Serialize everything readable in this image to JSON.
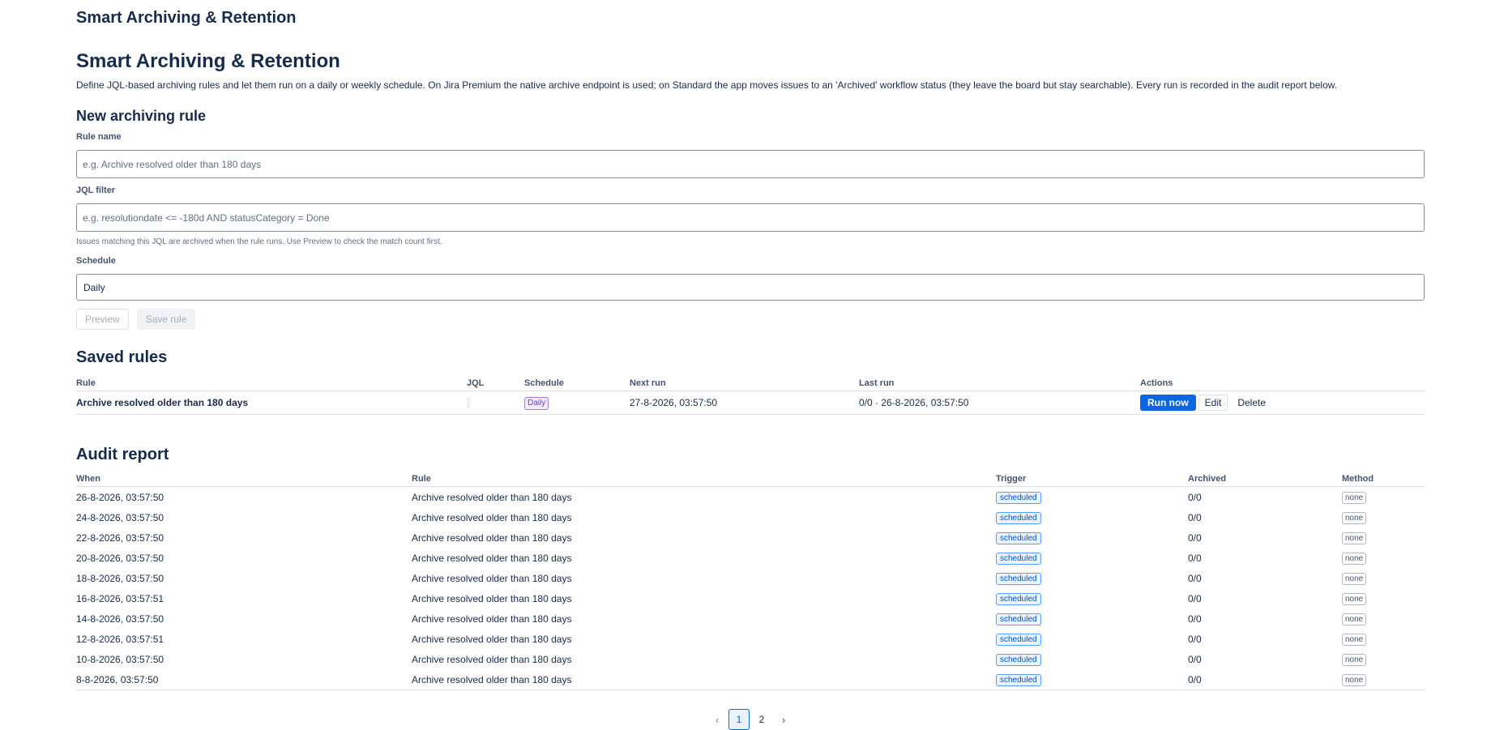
{
  "app": {
    "title": "Smart Archiving & Retention"
  },
  "main": {
    "title": "Smart Archiving & Retention",
    "description": "Define JQL-based archiving rules and let them run on a daily or weekly schedule. On Jira Premium the native archive endpoint is used; on Standard the app moves issues to an 'Archived' workflow status (they leave the board but stay searchable). Every run is recorded in the audit report below."
  },
  "new_rule": {
    "title": "New archiving rule",
    "rule_name_label": "Rule name",
    "rule_name_value": "",
    "rule_name_placeholder": "e.g. Archive resolved older than 180 days",
    "jql_label": "JQL filter",
    "jql_value": "",
    "jql_placeholder": "e.g. resolutiondate <= -180d AND statusCategory = Done",
    "jql_helper": "Issues matching this JQL are archived when the rule runs. Use Preview to check the match count first.",
    "schedule_label": "Schedule",
    "schedule_value": "Daily",
    "preview_label": "Preview",
    "save_label": "Save rule"
  },
  "saved_rules": {
    "title": "Saved rules",
    "headers": {
      "rule": "Rule",
      "jql": "JQL",
      "schedule": "Schedule",
      "next_run": "Next run",
      "last_run": "Last run",
      "actions": "Actions"
    },
    "rows": [
      {
        "rule": "Archive resolved older than 180 days",
        "schedule": "Daily",
        "next_run": "27-8-2026, 03:57:50",
        "last_run": "0/0 · 26-8-2026, 03:57:50",
        "run_now": "Run now",
        "edit": "Edit",
        "delete": "Delete"
      }
    ]
  },
  "audit": {
    "title": "Audit report",
    "headers": {
      "when": "When",
      "rule": "Rule",
      "trigger": "Trigger",
      "archived": "Archived",
      "method": "Method"
    },
    "rows": [
      {
        "when": "26-8-2026, 03:57:50",
        "rule": "Archive resolved older than 180 days",
        "trigger": "scheduled",
        "archived": "0/0",
        "method": "none"
      },
      {
        "when": "24-8-2026, 03:57:50",
        "rule": "Archive resolved older than 180 days",
        "trigger": "scheduled",
        "archived": "0/0",
        "method": "none"
      },
      {
        "when": "22-8-2026, 03:57:50",
        "rule": "Archive resolved older than 180 days",
        "trigger": "scheduled",
        "archived": "0/0",
        "method": "none"
      },
      {
        "when": "20-8-2026, 03:57:50",
        "rule": "Archive resolved older than 180 days",
        "trigger": "scheduled",
        "archived": "0/0",
        "method": "none"
      },
      {
        "when": "18-8-2026, 03:57:50",
        "rule": "Archive resolved older than 180 days",
        "trigger": "scheduled",
        "archived": "0/0",
        "method": "none"
      },
      {
        "when": "16-8-2026, 03:57:51",
        "rule": "Archive resolved older than 180 days",
        "trigger": "scheduled",
        "archived": "0/0",
        "method": "none"
      },
      {
        "when": "14-8-2026, 03:57:50",
        "rule": "Archive resolved older than 180 days",
        "trigger": "scheduled",
        "archived": "0/0",
        "method": "none"
      },
      {
        "when": "12-8-2026, 03:57:51",
        "rule": "Archive resolved older than 180 days",
        "trigger": "scheduled",
        "archived": "0/0",
        "method": "none"
      },
      {
        "when": "10-8-2026, 03:57:50",
        "rule": "Archive resolved older than 180 days",
        "trigger": "scheduled",
        "archived": "0/0",
        "method": "none"
      },
      {
        "when": "8-8-2026, 03:57:50",
        "rule": "Archive resolved older than 180 days",
        "trigger": "scheduled",
        "archived": "0/0",
        "method": "none"
      }
    ]
  },
  "pagination": {
    "prev_icon": "chevron-left-icon",
    "next_icon": "chevron-right-icon",
    "pages": [
      "1",
      "2"
    ],
    "current": "1"
  }
}
